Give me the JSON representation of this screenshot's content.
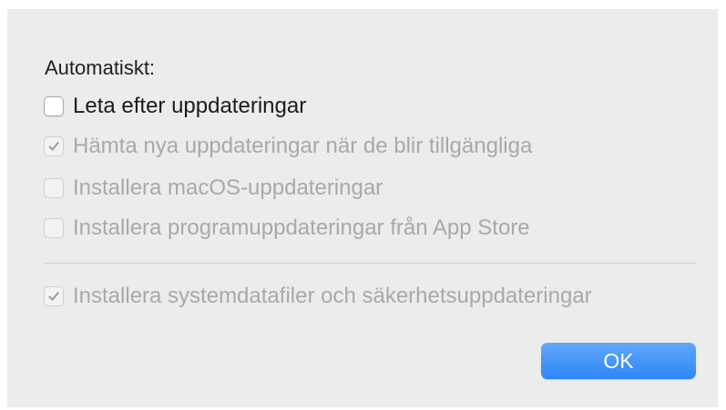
{
  "dialog": {
    "heading": "Automatiskt:",
    "options": [
      {
        "label": "Leta efter uppdateringar",
        "checked": false,
        "enabled": true
      },
      {
        "label": "Hämta nya uppdateringar när de blir tillgängliga",
        "checked": true,
        "enabled": false
      },
      {
        "label": "Installera macOS-uppdateringar",
        "checked": false,
        "enabled": false
      },
      {
        "label": "Installera programuppdateringar från App Store",
        "checked": false,
        "enabled": false
      },
      {
        "label": "Installera systemdatafiler och säkerhetsuppdateringar",
        "checked": true,
        "enabled": false
      }
    ],
    "ok_label": "OK"
  },
  "colors": {
    "dialog_background": "#ececec",
    "button_accent": "#2d86f6",
    "disabled_text": "#a9a9a9",
    "enabled_text": "#1b1b1b"
  },
  "icons": {
    "check": "checkmark-icon"
  }
}
